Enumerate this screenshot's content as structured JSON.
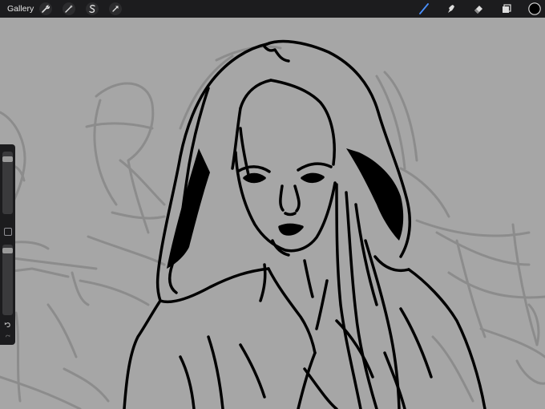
{
  "topbar": {
    "gallery_label": "Gallery",
    "left_tools": [
      {
        "name": "actions",
        "icon": "wrench-icon"
      },
      {
        "name": "adjustments",
        "icon": "magic-wand-icon"
      },
      {
        "name": "selection",
        "icon": "selection-s-icon"
      },
      {
        "name": "transform",
        "icon": "arrow-cursor-icon"
      }
    ],
    "right_tools": [
      {
        "name": "brush",
        "icon": "brush-icon",
        "active": true
      },
      {
        "name": "smudge",
        "icon": "smudge-finger-icon"
      },
      {
        "name": "eraser",
        "icon": "eraser-icon"
      },
      {
        "name": "layers",
        "icon": "layers-icon"
      },
      {
        "name": "color",
        "icon": "color-swatch-icon",
        "value": "#000000"
      }
    ]
  },
  "sidebar": {
    "brush_size": 0.08,
    "opacity": 0.05,
    "undo_icon": "undo-icon",
    "redo_icon": "redo-icon"
  },
  "colors": {
    "toolbar_bg": "#1c1c1e",
    "canvas_bg": "#a6a6a6",
    "active_tool": "#4a90ff",
    "ink": "#000000"
  }
}
